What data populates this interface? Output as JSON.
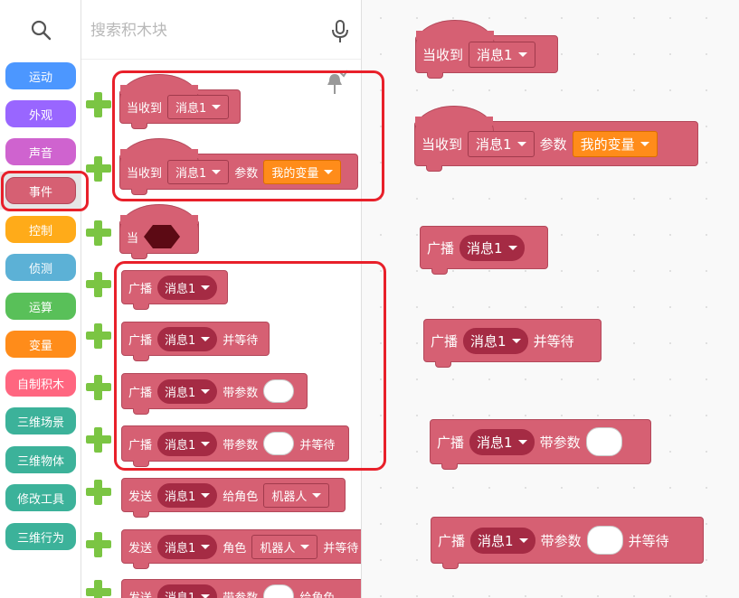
{
  "categories": [
    {
      "label": "运动",
      "color": "#4c97ff"
    },
    {
      "label": "外观",
      "color": "#9966ff"
    },
    {
      "label": "声音",
      "color": "#cf63cf"
    },
    {
      "label": "事件",
      "color": "#d66073"
    },
    {
      "label": "控制",
      "color": "#ffab19"
    },
    {
      "label": "侦测",
      "color": "#5cb1d6"
    },
    {
      "label": "运算",
      "color": "#59c059"
    },
    {
      "label": "变量",
      "color": "#ff8c1a"
    },
    {
      "label": "自制积木",
      "color": "#ff6680"
    },
    {
      "label": "三维场景",
      "color": "#3cb29a"
    },
    {
      "label": "三维物体",
      "color": "#3cb29a"
    },
    {
      "label": "修改工具",
      "color": "#3cb29a"
    },
    {
      "label": "三维行为",
      "color": "#3cb29a"
    }
  ],
  "search": {
    "placeholder": "搜索积木块"
  },
  "palette": {
    "when_receive": "当收到",
    "message1": "消息1",
    "param": "参数",
    "my_variable": "我的变量",
    "when": "当",
    "broadcast": "广播",
    "and_wait": "并等待",
    "with_param": "带参数",
    "send": "发送",
    "to_role": "给角色",
    "role": "角色",
    "robot": "机器人"
  },
  "workspace": {
    "when_receive": "当收到",
    "message1": "消息1",
    "param": "参数",
    "my_variable": "我的变量",
    "broadcast": "广播",
    "and_wait": "并等待",
    "with_param": "带参数"
  },
  "colors": {
    "event": "#d66073",
    "highlight": "#e8202a",
    "add": "#7bc543"
  }
}
